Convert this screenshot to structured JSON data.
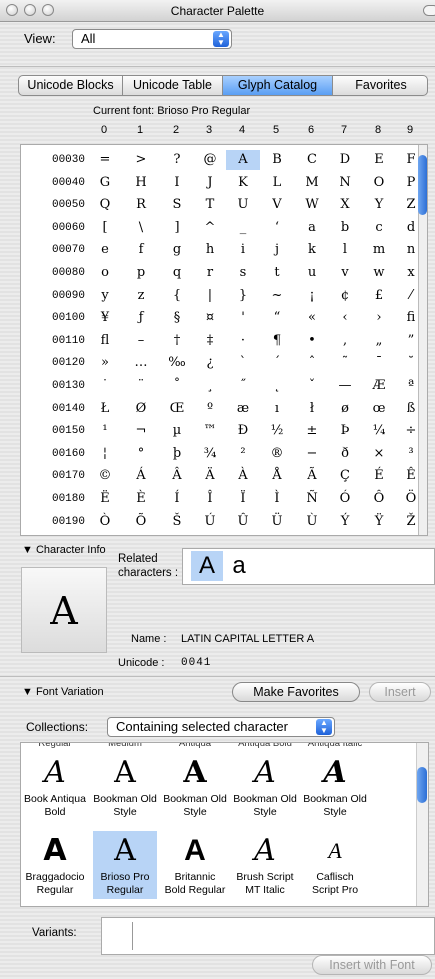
{
  "window": {
    "title": "Character Palette"
  },
  "view": {
    "label": "View:",
    "value": "All"
  },
  "tabs": [
    "Unicode Blocks",
    "Unicode Table",
    "Glyph Catalog",
    "Favorites"
  ],
  "current_font": "Current font: Brioso Pro Regular",
  "columns": [
    "0",
    "1",
    "2",
    "3",
    "4",
    "5",
    "6",
    "7",
    "8",
    "9"
  ],
  "rows": [
    {
      "code": "00030",
      "glyphs": [
        "=",
        ">",
        "?",
        "@",
        "A",
        "B",
        "C",
        "D",
        "E",
        "F"
      ]
    },
    {
      "code": "00040",
      "glyphs": [
        "G",
        "H",
        "I",
        "J",
        "K",
        "L",
        "M",
        "N",
        "O",
        "P"
      ]
    },
    {
      "code": "00050",
      "glyphs": [
        "Q",
        "R",
        "S",
        "T",
        "U",
        "V",
        "W",
        "X",
        "Y",
        "Z"
      ]
    },
    {
      "code": "00060",
      "glyphs": [
        "[",
        "\\",
        "]",
        "^",
        "_",
        "‘",
        "a",
        "b",
        "c",
        "d"
      ]
    },
    {
      "code": "00070",
      "glyphs": [
        "e",
        "f",
        "g",
        "h",
        "i",
        "j",
        "k",
        "l",
        "m",
        "n"
      ]
    },
    {
      "code": "00080",
      "glyphs": [
        "o",
        "p",
        "q",
        "r",
        "s",
        "t",
        "u",
        "v",
        "w",
        "x"
      ]
    },
    {
      "code": "00090",
      "glyphs": [
        "y",
        "z",
        "{",
        "|",
        "}",
        "~",
        "¡",
        "¢",
        "£",
        "⁄"
      ]
    },
    {
      "code": "00100",
      "glyphs": [
        "¥",
        "ƒ",
        "§",
        "¤",
        "'",
        "“",
        "«",
        "‹",
        "›",
        "ﬁ"
      ]
    },
    {
      "code": "00110",
      "glyphs": [
        "ﬂ",
        "–",
        "†",
        "‡",
        "·",
        "¶",
        "•",
        "‚",
        "„",
        "”"
      ]
    },
    {
      "code": "00120",
      "glyphs": [
        "»",
        "…",
        "‰",
        "¿",
        "`",
        "´",
        "ˆ",
        "˜",
        "¯",
        "˘"
      ]
    },
    {
      "code": "00130",
      "glyphs": [
        "˙",
        "¨",
        "˚",
        "¸",
        "˝",
        "˛",
        "ˇ",
        "—",
        "Æ",
        "ª"
      ]
    },
    {
      "code": "00140",
      "glyphs": [
        "Ł",
        "Ø",
        "Œ",
        "º",
        "æ",
        "ı",
        "ł",
        "ø",
        "œ",
        "ß"
      ]
    },
    {
      "code": "00150",
      "glyphs": [
        "¹",
        "¬",
        "µ",
        "™",
        "Ð",
        "½",
        "±",
        "Þ",
        "¼",
        "÷"
      ]
    },
    {
      "code": "00160",
      "glyphs": [
        "¦",
        "°",
        "þ",
        "¾",
        "²",
        "®",
        "−",
        "ð",
        "×",
        "³"
      ]
    },
    {
      "code": "00170",
      "glyphs": [
        "©",
        "Á",
        "Â",
        "Ä",
        "À",
        "Å",
        "Ã",
        "Ç",
        "É",
        "Ê"
      ]
    },
    {
      "code": "00180",
      "glyphs": [
        "Ë",
        "È",
        "Í",
        "Î",
        "Ï",
        "Ì",
        "Ñ",
        "Ó",
        "Ô",
        "Ö"
      ]
    },
    {
      "code": "00190",
      "glyphs": [
        "Ò",
        "Õ",
        "Š",
        "Ú",
        "Û",
        "Ü",
        "Ù",
        "Ý",
        "Ÿ",
        "Ž"
      ]
    }
  ],
  "char_info": {
    "header": "▼ Character Info",
    "glyph": "A",
    "related_label": "Related characters :",
    "related": [
      "A",
      "a"
    ],
    "name_label": "Name :",
    "name": "LATIN CAPITAL LETTER A",
    "unicode_label": "Unicode :",
    "unicode": "0041"
  },
  "font_variation": {
    "header": "▼ Font Variation",
    "make_favorites": "Make Favorites",
    "insert": "Insert",
    "collections_label": "Collections:",
    "collections_value": "Containing selected character",
    "top_labels": [
      "Regular",
      "Medium",
      "Antiqua",
      "Antiqua Bold",
      "Antiqua Italic"
    ],
    "fonts_row1": [
      {
        "glyph": "A",
        "name": "Book Antiqua Bold"
      },
      {
        "glyph": "A",
        "name": "Bookman Old Style"
      },
      {
        "glyph": "A",
        "name": "Bookman Old Style"
      },
      {
        "glyph": "A",
        "name": "Bookman Old Style"
      },
      {
        "glyph": "A",
        "name": "Bookman Old Style"
      }
    ],
    "fonts_row2": [
      {
        "glyph": "A",
        "name": "Braggadocio Regular"
      },
      {
        "glyph": "A",
        "name": "Brioso Pro Regular"
      },
      {
        "glyph": "A",
        "name": "Britannic Bold Regular"
      },
      {
        "glyph": "A",
        "name": "Brush Script MT Italic"
      },
      {
        "glyph": "A",
        "name": "Caflisch Script Pro"
      }
    ],
    "variants_label": "Variants:",
    "insert_with_font": "Insert with Font"
  }
}
